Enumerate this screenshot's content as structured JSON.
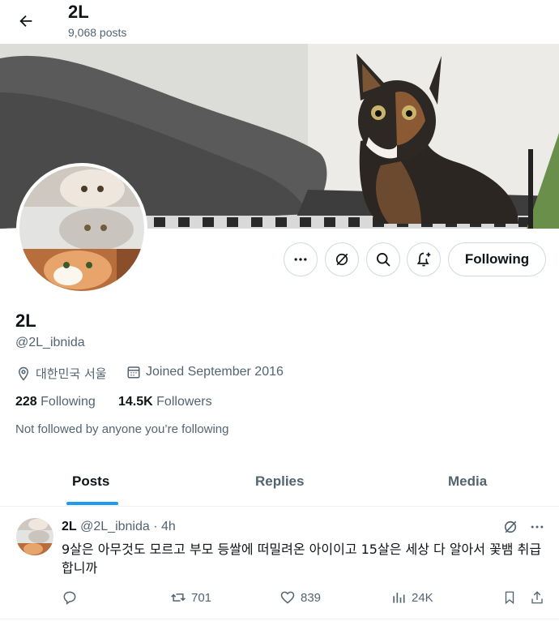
{
  "header": {
    "title": "2L",
    "post_count": "9,068 posts"
  },
  "actions": {
    "more_icon": "more-icon",
    "grok_icon": "grok-icon",
    "search_icon": "search-icon",
    "notify_icon": "bell-plus-icon",
    "follow_label": "Following"
  },
  "profile": {
    "name": "2L",
    "handle": "@2L_ibnida",
    "location": "대한민국 서울",
    "joined": "Joined September 2016",
    "following_count": "228",
    "following_label": "Following",
    "followers_count": "14.5K",
    "followers_label": "Followers",
    "not_followed": "Not followed by anyone you’re following"
  },
  "tabs": [
    {
      "label": "Posts",
      "active": true
    },
    {
      "label": "Replies",
      "active": false
    },
    {
      "label": "Media",
      "active": false
    }
  ],
  "post": {
    "name": "2L",
    "handle": "@2L_ibnida",
    "dot": "·",
    "time": "4h",
    "text": "9살은 아무것도 모르고 부모 등쌀에 떠밀려온 아이이고 15살은 세상 다 알아서 꽃뱀 취급 합니까",
    "replies": "",
    "reposts": "701",
    "likes": "839",
    "views": "24K"
  },
  "colors": {
    "accent": "#1d9bf0",
    "text": "#0f1419",
    "muted": "#536471",
    "border": "#cfd9de"
  }
}
